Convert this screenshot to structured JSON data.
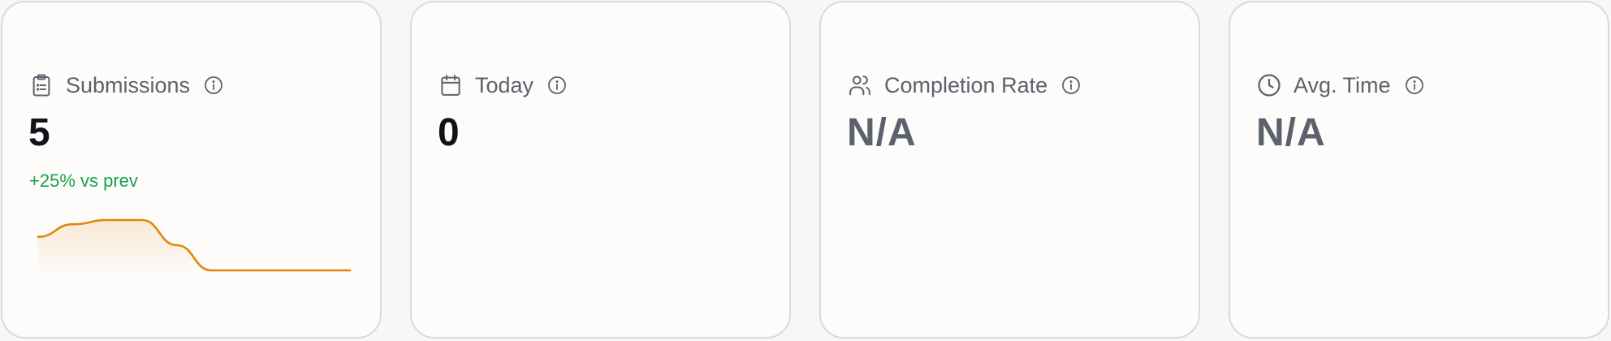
{
  "stats": [
    {
      "title": "Submissions",
      "icon": "clipboard-icon",
      "value": "5",
      "delta": "+25% vs prev",
      "trend": [
        0.4,
        0.55,
        0.6,
        0.6,
        0.3,
        0,
        0,
        0,
        0,
        0
      ],
      "accent": "#e0870f",
      "delta_color": "#16a34a"
    },
    {
      "title": "Today",
      "icon": "calendar-icon",
      "value": "0"
    },
    {
      "title": "Completion Rate",
      "icon": "users-icon",
      "value": "N/A"
    },
    {
      "title": "Avg. Time",
      "icon": "clock-icon",
      "value": "N/A"
    }
  ]
}
